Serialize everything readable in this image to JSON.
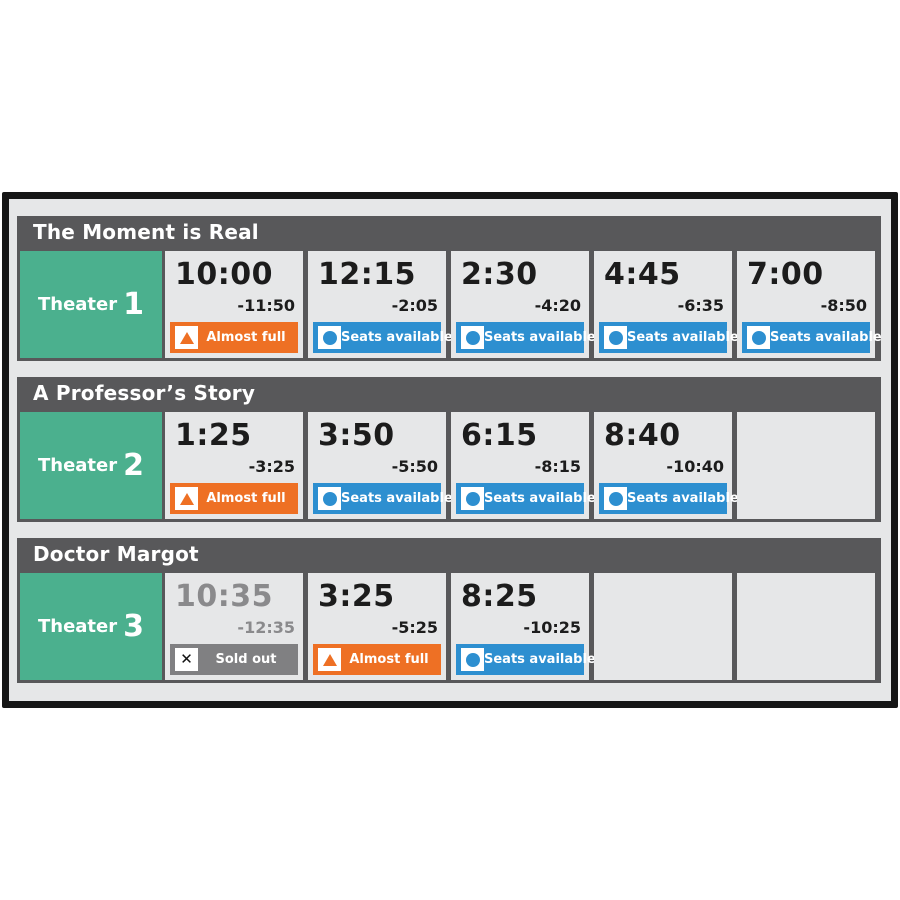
{
  "colors": {
    "theater_green": "#4bb08e",
    "header_gray": "#58585a",
    "almost_full": "#ee7024",
    "seats_available": "#2d8fd0",
    "sold_out": "#808082"
  },
  "status_labels": {
    "almost_full": "Almost full",
    "seats_available": "Seats available",
    "sold_out": "Sold out"
  },
  "movies": [
    {
      "title": "The Moment is Real",
      "theater_label": "Theater",
      "theater_number": "1",
      "showtimes": [
        {
          "time": "10:00",
          "remaining": "-11:50",
          "status": "Almost full",
          "icon": "triangle-icon"
        },
        {
          "time": "12:15",
          "remaining": "-2:05",
          "status": "Seats available",
          "icon": "circle-icon"
        },
        {
          "time": "2:30",
          "remaining": "-4:20",
          "status": "Seats available",
          "icon": "circle-icon"
        },
        {
          "time": "4:45",
          "remaining": "-6:35",
          "status": "Seats available",
          "icon": "circle-icon"
        },
        {
          "time": "7:00",
          "remaining": "-8:50",
          "status": "Seats available",
          "icon": "circle-icon"
        }
      ]
    },
    {
      "title": "A Professor’s Story",
      "theater_label": "Theater",
      "theater_number": "2",
      "showtimes": [
        {
          "time": "1:25",
          "remaining": "-3:25",
          "status": "Almost full",
          "icon": "triangle-icon"
        },
        {
          "time": "3:50",
          "remaining": "-5:50",
          "status": "Seats available",
          "icon": "circle-icon"
        },
        {
          "time": "6:15",
          "remaining": "-8:15",
          "status": "Seats available",
          "icon": "circle-icon"
        },
        {
          "time": "8:40",
          "remaining": "-10:40",
          "status": "Seats available",
          "icon": "circle-icon"
        }
      ]
    },
    {
      "title": "Doctor Margot",
      "theater_label": "Theater",
      "theater_number": "3",
      "showtimes": [
        {
          "time": "10:35",
          "remaining": "-12:35",
          "status": "Sold out",
          "icon": "x-icon"
        },
        {
          "time": "3:25",
          "remaining": "-5:25",
          "status": "Almost full",
          "icon": "triangle-icon"
        },
        {
          "time": "8:25",
          "remaining": "-10:25",
          "status": "Seats available",
          "icon": "circle-icon"
        }
      ]
    }
  ]
}
